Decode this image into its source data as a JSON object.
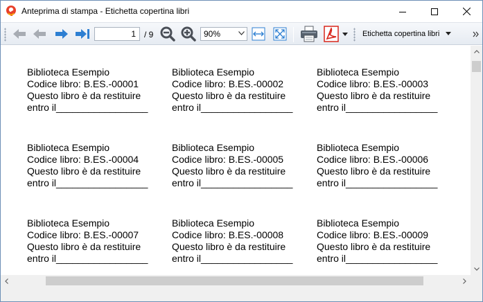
{
  "window": {
    "title": "Anteprima di stampa - Etichetta copertina libri"
  },
  "toolbar": {
    "current_page": "1",
    "total_pages": "/ 9",
    "zoom": "90%",
    "report_name": "Etichetta copertina libri",
    "icons": [
      "first-page-icon",
      "previous-page-icon",
      "next-page-icon",
      "last-page-icon",
      "zoom-out-icon",
      "zoom-in-icon",
      "fit-width-icon",
      "fit-page-icon",
      "print-icon",
      "pdf-icon"
    ],
    "colors": {
      "nav_blue": "#2d7fd2",
      "pdf_red": "#d8261c",
      "zoom_gray": "#4a4f57"
    }
  },
  "labels": [
    {
      "title": "Biblioteca Esempio",
      "code": "Codice libro: B.ES.-00001",
      "note": "Questo libro è da restituire",
      "due": "entro il_________________"
    },
    {
      "title": "Biblioteca Esempio",
      "code": "Codice libro: B.ES.-00002",
      "note": "Questo libro è da restituire",
      "due": "entro il_________________"
    },
    {
      "title": "Biblioteca Esempio",
      "code": "Codice libro: B.ES.-00003",
      "note": "Questo libro è da restituire",
      "due": "entro il_________________"
    },
    {
      "title": "Biblioteca Esempio",
      "code": "Codice libro: B.ES.-00004",
      "note": "Questo libro è da restituire",
      "due": "entro il_________________"
    },
    {
      "title": "Biblioteca Esempio",
      "code": "Codice libro: B.ES.-00005",
      "note": "Questo libro è da restituire",
      "due": "entro il_________________"
    },
    {
      "title": "Biblioteca Esempio",
      "code": "Codice libro: B.ES.-00006",
      "note": "Questo libro è da restituire",
      "due": "entro il_________________"
    },
    {
      "title": "Biblioteca Esempio",
      "code": "Codice libro: B.ES.-00007",
      "note": "Questo libro è da restituire",
      "due": "entro il_________________"
    },
    {
      "title": "Biblioteca Esempio",
      "code": "Codice libro: B.ES.-00008",
      "note": "Questo libro è da restituire",
      "due": "entro il_________________"
    },
    {
      "title": "Biblioteca Esempio",
      "code": "Codice libro: B.ES.-00009",
      "note": "Questo libro è da restituire",
      "due": "entro il_________________"
    }
  ]
}
